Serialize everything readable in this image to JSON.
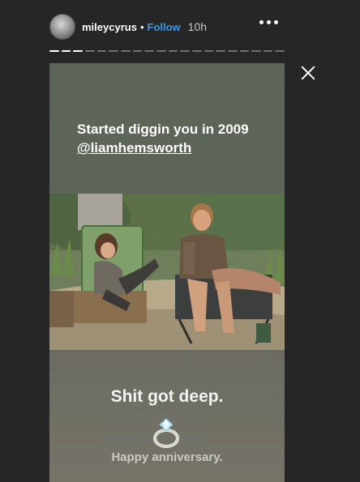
{
  "header": {
    "username": "mileycyrus",
    "separator": "•",
    "follow_label": "Follow",
    "time": "10h"
  },
  "progress": {
    "total_segments": 20,
    "completed_segments": 3
  },
  "story": {
    "caption_line1": "Started diggin you in 2009",
    "mention": "@liamhemsworth",
    "text_deep": "Shit got deep.",
    "ring_emoji": "ring-icon",
    "text_anniversary": "Happy anniversary."
  },
  "colors": {
    "background": "#262626",
    "follow": "#3897f0",
    "text": "#ffffff"
  }
}
